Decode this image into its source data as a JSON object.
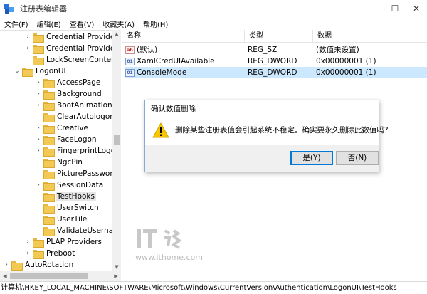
{
  "window": {
    "title": "注册表编辑器",
    "controls": {
      "minimize": "—",
      "maximize": "☐",
      "close": "✕"
    }
  },
  "menu": [
    "文件(F)",
    "编辑(E)",
    "查看(V)",
    "收藏夹(A)",
    "帮助(H)"
  ],
  "tree": [
    {
      "label": "Credential Provider Filte",
      "expander": "›"
    },
    {
      "label": "Credential Providers",
      "expander": "›"
    },
    {
      "label": "LockScreenContent",
      "expander": ""
    },
    {
      "label": "LogonUI",
      "expander": "⌄"
    },
    {
      "label": "AccessPage",
      "expander": "›"
    },
    {
      "label": "Background",
      "expander": "›"
    },
    {
      "label": "BootAnimation",
      "expander": "›"
    },
    {
      "label": "ClearAutologon",
      "expander": ""
    },
    {
      "label": "Creative",
      "expander": "›"
    },
    {
      "label": "FaceLogon",
      "expander": "›"
    },
    {
      "label": "FingerprintLogon",
      "expander": "›"
    },
    {
      "label": "NgcPin",
      "expander": ""
    },
    {
      "label": "PicturePassword",
      "expander": ""
    },
    {
      "label": "SessionData",
      "expander": "›"
    },
    {
      "label": "TestHooks",
      "expander": "",
      "selected": true
    },
    {
      "label": "UserSwitch",
      "expander": ""
    },
    {
      "label": "UserTile",
      "expander": ""
    },
    {
      "label": "ValidateUsername",
      "expander": ""
    },
    {
      "label": "PLAP Providers",
      "expander": "›"
    },
    {
      "label": "Preboot",
      "expander": "›"
    },
    {
      "label": "AutoRotation",
      "expander": "›"
    }
  ],
  "list": {
    "headers": {
      "name": "名称",
      "type": "类型",
      "data": "数据"
    },
    "rows": [
      {
        "icon": "ab",
        "name": "(默认)",
        "type": "REG_SZ",
        "data": "(数值未设置)"
      },
      {
        "icon": "01",
        "name": "XamlCredUIAvailable",
        "type": "REG_DWORD",
        "data": "0x00000001 (1)"
      },
      {
        "icon": "01",
        "name": "ConsoleMode",
        "type": "REG_DWORD",
        "data": "0x00000001 (1)",
        "selected": true
      }
    ]
  },
  "dialog": {
    "title": "确认数值删除",
    "message": "删除某些注册表值会引起系统不稳定。确实要永久删除此数值吗?",
    "yes": "是(Y)",
    "no": "否(N)"
  },
  "watermark": {
    "logo": "IT之家",
    "url": "www.ithome.com"
  },
  "statusbar": {
    "path": "计算机\\HKEY_LOCAL_MACHINE\\SOFTWARE\\Microsoft\\Windows\\CurrentVersion\\Authentication\\LogonUI\\TestHooks"
  }
}
